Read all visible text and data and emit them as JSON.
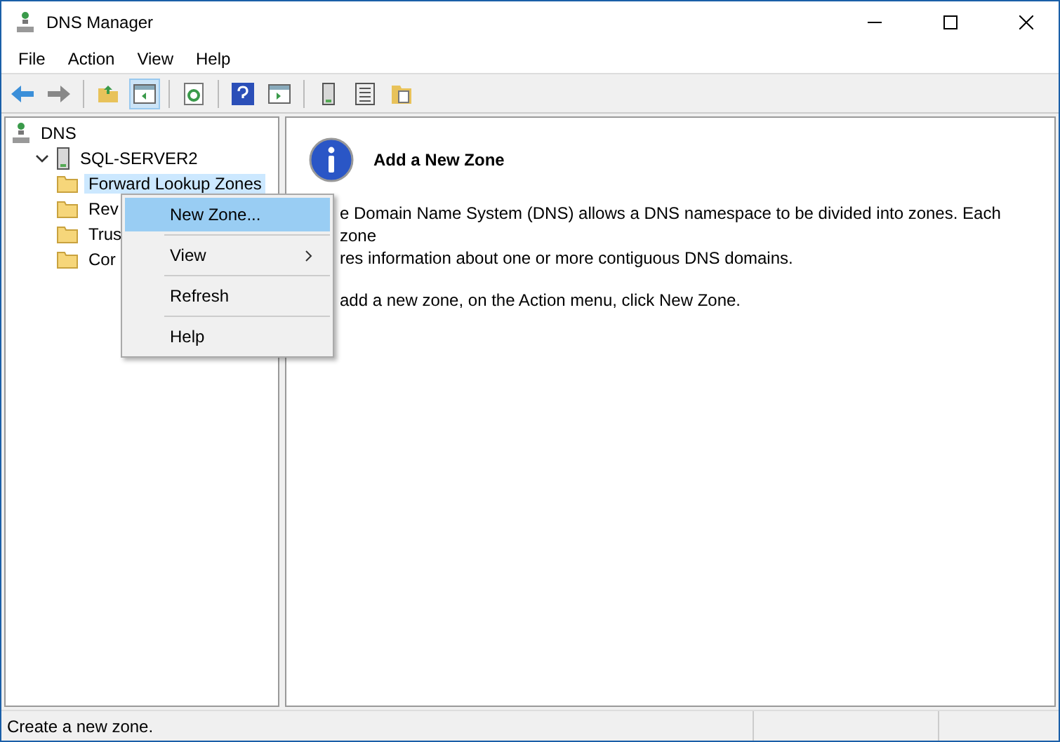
{
  "window": {
    "title": "DNS Manager"
  },
  "menu": [
    "File",
    "Action",
    "View",
    "Help"
  ],
  "tree": [
    {
      "label": "DNS",
      "kind": "dns",
      "selected": false,
      "children": [
        {
          "label": "SQL-SERVER2",
          "kind": "server",
          "expanded": true,
          "selected": false,
          "children": [
            {
              "label": "Forward Lookup Zones",
              "kind": "folder",
              "selected": true
            },
            {
              "label": "Rev",
              "kind": "folder",
              "selected": false
            },
            {
              "label": "Trus",
              "kind": "folder",
              "selected": false
            },
            {
              "label": "Cor",
              "kind": "folder",
              "selected": false
            }
          ]
        }
      ]
    }
  ],
  "content": {
    "title": "Add a New Zone",
    "paragraphs": [
      "e Domain Name System (DNS) allows a DNS namespace to be divided into zones. Each zone\nres information about one or more contiguous DNS domains.",
      "add a new zone, on the Action menu, click New Zone."
    ]
  },
  "context_menu": [
    {
      "label": "New Zone...",
      "selected": true,
      "submenu": false
    },
    {
      "label": "View",
      "selected": false,
      "submenu": true
    },
    {
      "label": "Refresh",
      "selected": false,
      "submenu": false
    },
    {
      "label": "Help",
      "selected": false,
      "submenu": false
    }
  ],
  "status_bar": {
    "text": "Create a new zone."
  }
}
